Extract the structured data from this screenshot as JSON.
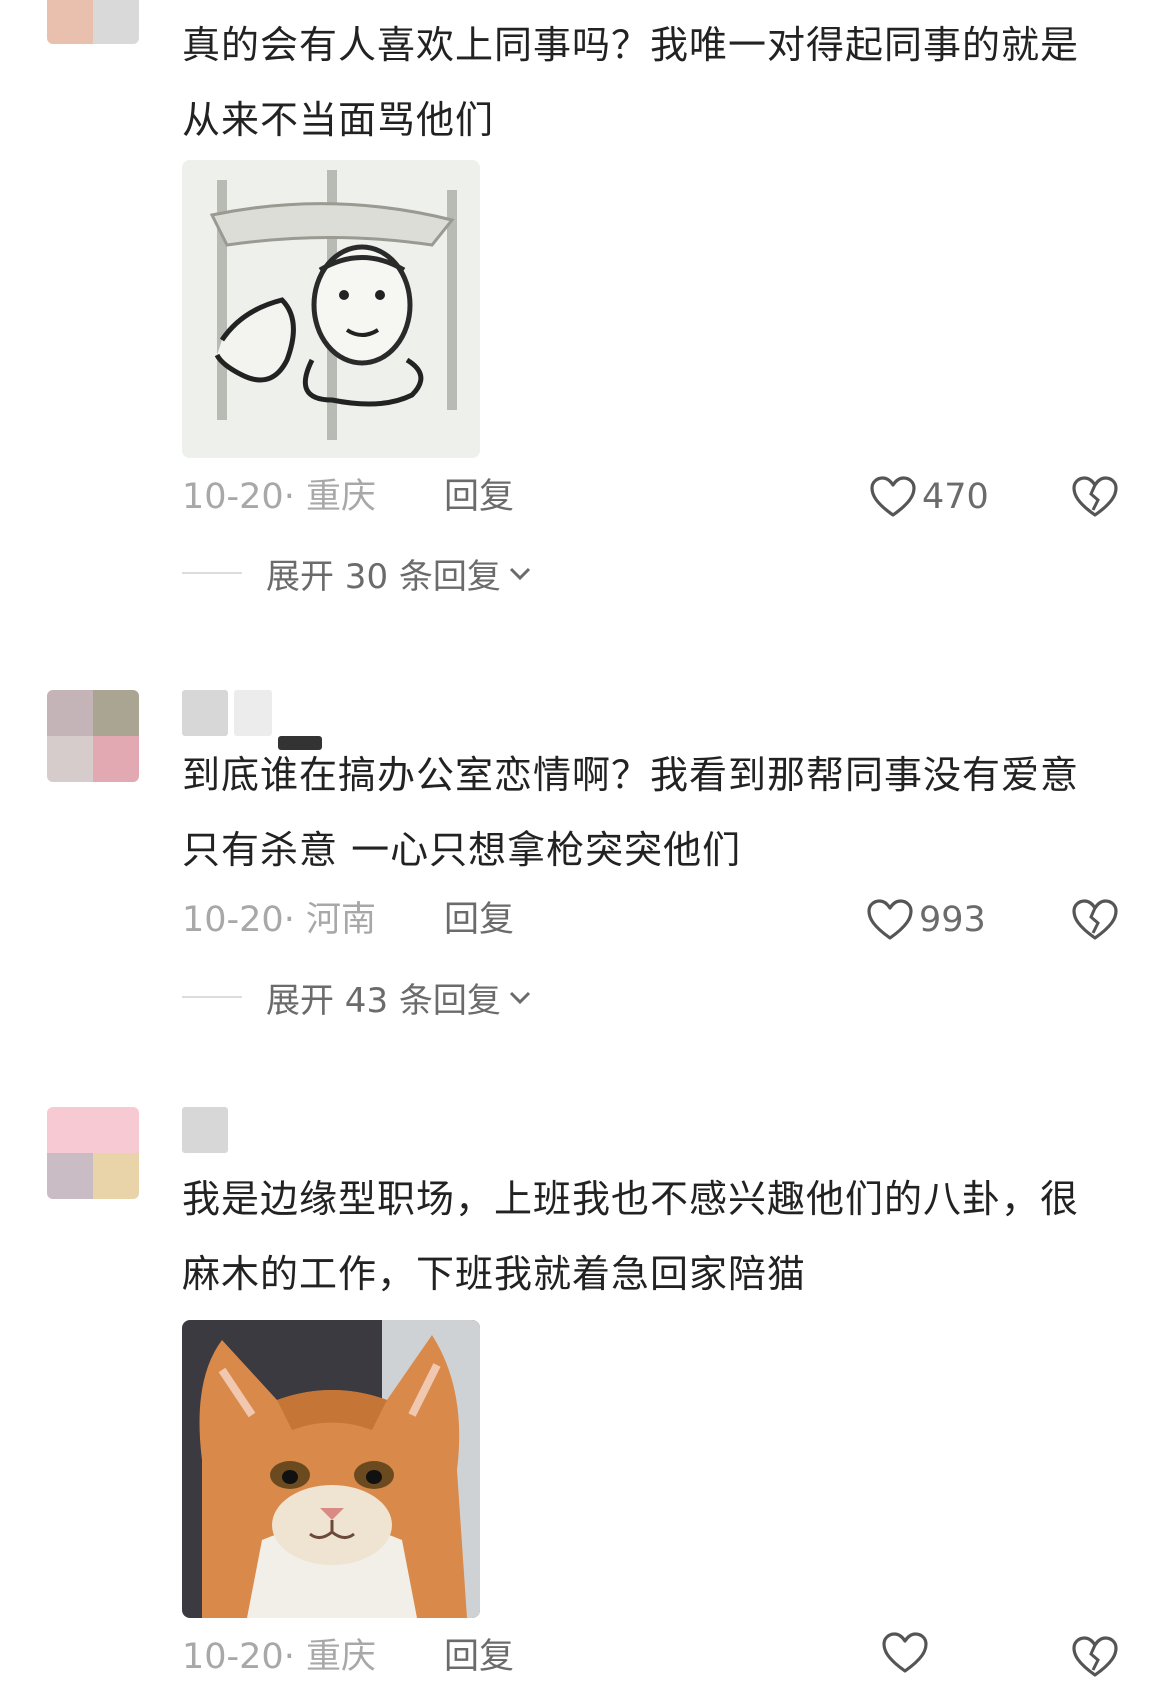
{
  "comments": [
    {
      "text": "真的会有人喜欢上同事吗？我唯一对得起同事的就是从来不当面骂他们",
      "date": "10-20",
      "location": "· 重庆",
      "reply_label": "回复",
      "likes": "470",
      "expand_label": "展开 30 条回复",
      "image": "meme-sketch-face",
      "avatar_colors": [
        "#e8c0ad",
        "#d9d9d9"
      ]
    },
    {
      "text": "到底谁在搞办公室恋情啊？我看到那帮同事没有爱意只有杀意 一心只想拿枪突突他们",
      "date": "10-20",
      "location": "· 河南",
      "reply_label": "回复",
      "likes": "993",
      "expand_label": "展开 43 条回复",
      "avatar_colors": [
        "#c4b4b8",
        "#a9a592",
        "#d6cccc",
        "#e3a9b3"
      ]
    },
    {
      "text": "我是边缘型职场，上班我也不感兴趣他们的八卦，很麻木的工作，下班我就着急回家陪猫",
      "date": "10-20",
      "location": "· 重庆",
      "reply_label": "回复",
      "image": "sad-orange-cat",
      "avatar_colors": [
        "#f6c9d3",
        "#f6c9d3",
        "#c9bcc5",
        "#e9d3a8"
      ]
    }
  ],
  "colors": {
    "muted_text": "#a8a8a8",
    "secondary_text": "#6b6b6b",
    "primary_text": "#222222"
  }
}
